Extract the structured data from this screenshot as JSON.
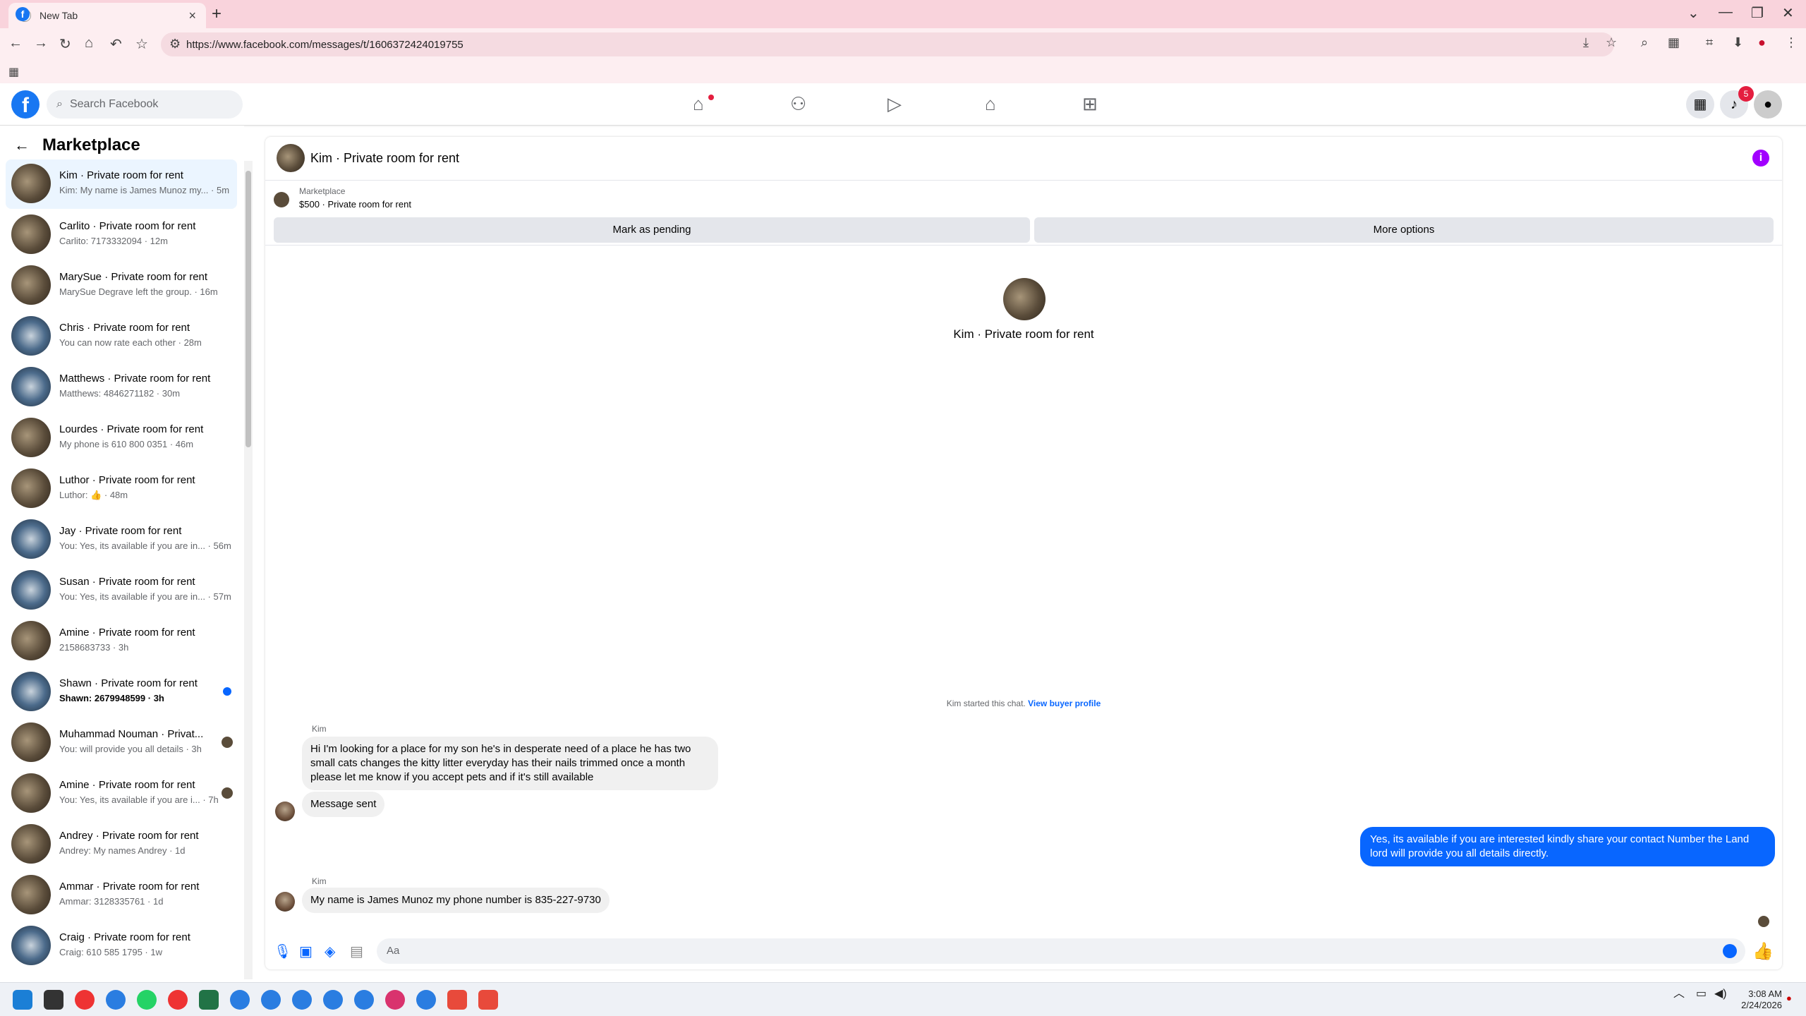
{
  "browser": {
    "tab_title": "New Tab",
    "tab_close": "×",
    "new_tab": "+",
    "url": "https://www.facebook.com/messages/t/1606372424019755",
    "icons": [
      "back-icon",
      "forward-icon",
      "reload-icon",
      "home-icon",
      "undo-icon",
      "star-icon",
      "site-info-icon",
      "install-icon",
      "bookmark-icon",
      "zoom-icon",
      "extensions-icon",
      "crop-icon",
      "download-icon",
      "profile-icon",
      "menu-icon"
    ]
  },
  "fb": {
    "logo": "f",
    "search_placeholder": "Search Facebook",
    "notif_count": "5"
  },
  "sidebar": {
    "title": "Marketplace",
    "conversations": [
      {
        "name": "Kim · Private room for rent",
        "snippet": "Kim: My name is James Munoz my... · 5m",
        "active": true
      },
      {
        "name": "Carlito · Private room for rent",
        "snippet": "Carlito: 7173332094 · 12m"
      },
      {
        "name": "MarySue · Private room for rent",
        "snippet": "MarySue Degrave left the group. · 16m"
      },
      {
        "name": "Chris · Private room for rent",
        "snippet": "You can now rate each other · 28m"
      },
      {
        "name": "Matthews · Private room for rent",
        "snippet": "Matthews: 4846271182 · 30m"
      },
      {
        "name": "Lourdes · Private room for rent",
        "snippet": "My phone is 610 800 0351 · 46m"
      },
      {
        "name": "Luthor · Private room for rent",
        "snippet": "Luthor: 👍 · 48m"
      },
      {
        "name": "Jay · Private room for rent",
        "snippet": "You: Yes, its available if you are in... · 56m"
      },
      {
        "name": "Susan · Private room for rent",
        "snippet": "You: Yes, its available if you are in... · 57m"
      },
      {
        "name": "Amine · Private room for rent",
        "snippet": "2158683733 · 3h"
      },
      {
        "name": "Shawn · Private room for rent",
        "snippet": "Shawn: 2679948599 · 3h",
        "unread": true
      },
      {
        "name": "Muhammad Nouman · Privat...",
        "snippet": "You: will provide you all details · 3h"
      },
      {
        "name": "Amine · Private room for rent",
        "snippet": "You: Yes, its available if you are i... · 7h"
      },
      {
        "name": "Andrey · Private room for rent",
        "snippet": "Andrey: My names Andrey · 1d"
      },
      {
        "name": "Ammar · Private room for rent",
        "snippet": "Ammar: 3128335761 · 1d"
      },
      {
        "name": "Craig · Private room for rent",
        "snippet": "Craig: 610 585 1795 · 1w"
      }
    ]
  },
  "chat": {
    "title": "Kim · Private room for rent",
    "listing_source": "Marketplace",
    "listing_price": "$500 · Private room for rent",
    "mark_pending": "Mark as pending",
    "more_options": "More options",
    "center_name": "Kim · Private room for rent",
    "started_text": "Kim started this chat.",
    "view_buyer": "View buyer profile",
    "sender1": "Kim",
    "msg1": "Hi I'm looking for a place for my son he's in desperate need of a place he has two small cats changes the kitty litter everyday has their nails trimmed once a month please let me know if you accept pets and if it's still available",
    "msg2": "Message sent",
    "msg3": "Yes, its available if you are interested kindly share your contact Number the Land lord will provide you all details directly.",
    "sender2": "Kim",
    "msg4": "My name is James Munoz my phone number is 835-227-9730",
    "composer_placeholder": "Aa"
  },
  "taskbar": {
    "time": "3:08 AM",
    "date": "2/24/2026"
  },
  "colors": {
    "facebook_blue": "#1877f2",
    "messenger_blue": "#0866ff",
    "tab_pink": "#f9d3dc"
  }
}
